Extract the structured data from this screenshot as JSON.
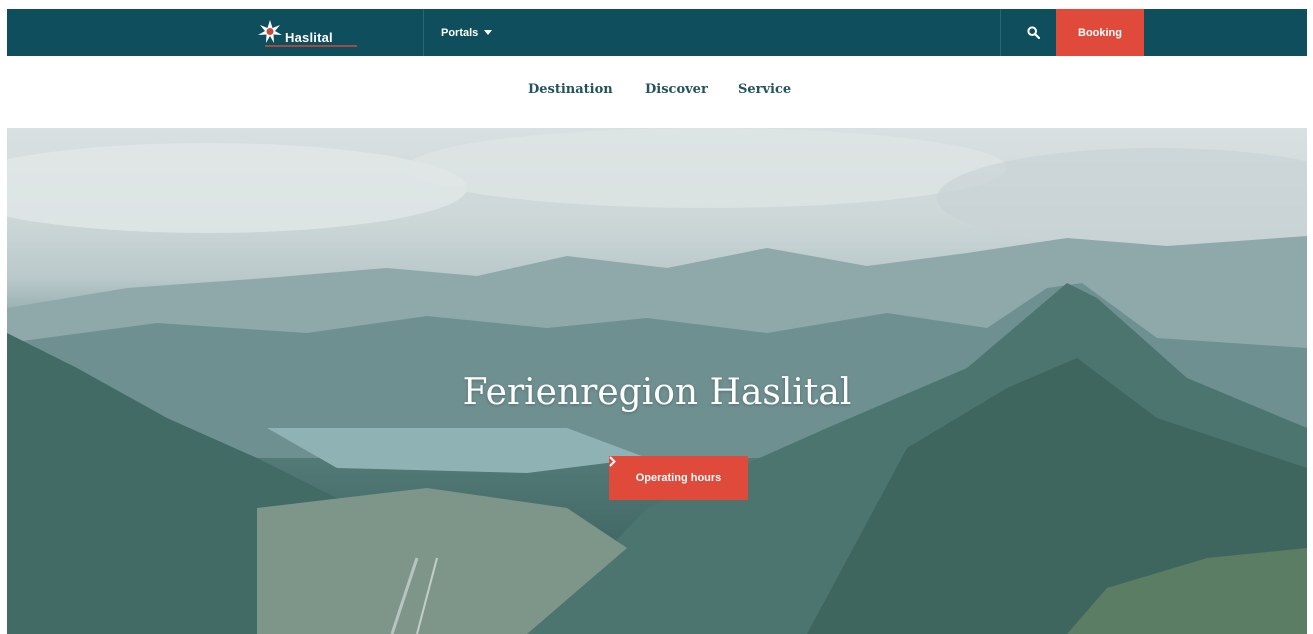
{
  "header": {
    "logo_text": "Haslital",
    "portals_label": "Portals",
    "booking_label": "Booking",
    "icons": {
      "logo": "star-logo-icon",
      "dropdown": "chevron-down-icon",
      "search": "search-icon"
    }
  },
  "subnav": {
    "items": [
      {
        "label": "Destination"
      },
      {
        "label": "Discover"
      },
      {
        "label": "Service"
      }
    ]
  },
  "hero": {
    "title": "Ferienregion Haslital",
    "cta_label": "Operating hours",
    "cta_icon": "chevron-right-icon",
    "image": "mountain-valley-landscape"
  },
  "colors": {
    "topbar": "#0f4e5c",
    "accent": "#df4a3a",
    "subnav_text": "#22535e"
  }
}
